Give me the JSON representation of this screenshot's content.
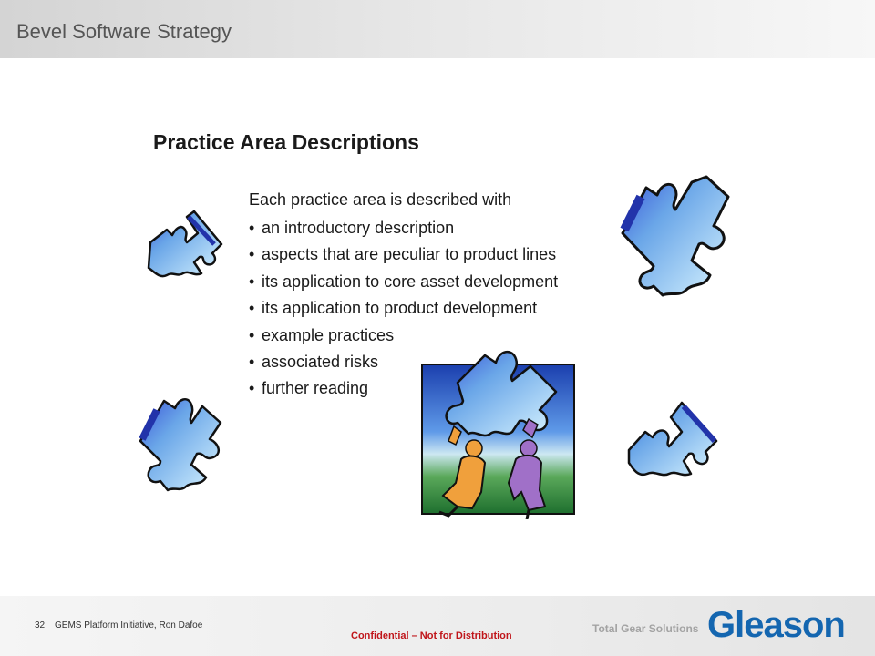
{
  "header": {
    "title": "Bevel Software Strategy"
  },
  "slide": {
    "heading": "Practice Area Descriptions",
    "intro": "Each practice area is described with",
    "bullets": [
      "an introductory description",
      "aspects that are peculiar to product lines",
      "its application to core asset development",
      "its application to product development",
      "example practices",
      "associated risks",
      "further reading"
    ],
    "bullet_glyph": "•"
  },
  "footer": {
    "page_number": "32",
    "presenter": "GEMS Platform Initiative,  Ron Dafoe",
    "confidential": "Confidential  – Not for Distribution",
    "tagline": "Total Gear Solutions",
    "logo": "Gleason"
  },
  "colors": {
    "accent_blue": "#1466b0",
    "confidential_red": "#c0151a",
    "puzzle_blue": "#6aa6e8"
  },
  "icons": [
    "puzzle-piece-icon",
    "people-holding-puzzle-icon"
  ]
}
